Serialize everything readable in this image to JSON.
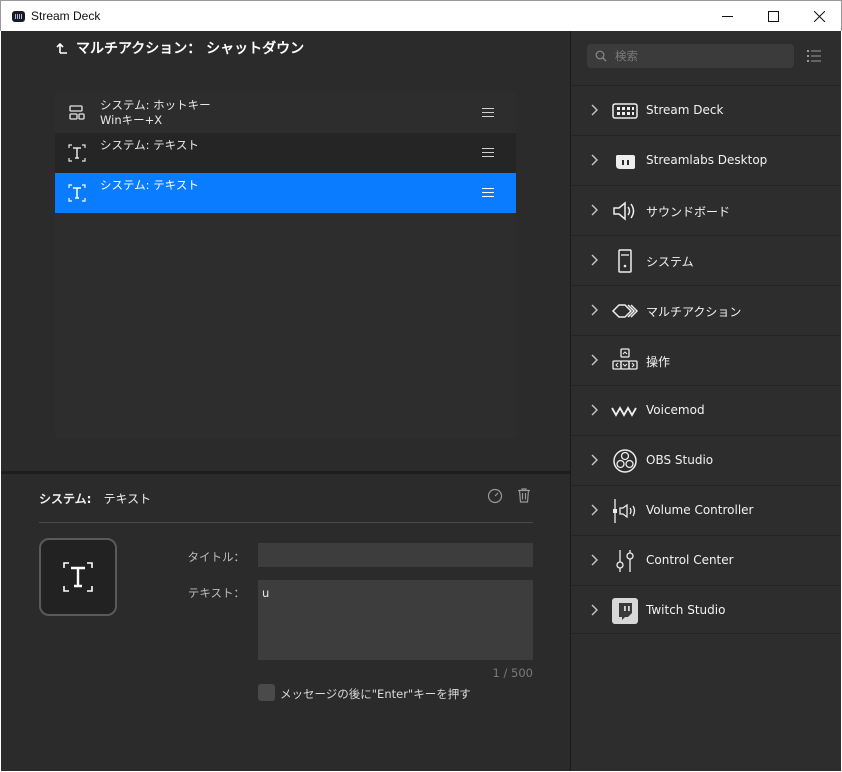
{
  "window": {
    "title": "Stream Deck"
  },
  "editor": {
    "title": "マルチアクション： シャットダウン",
    "actions": [
      {
        "line1": "システム: ホットキー",
        "line2": "Winキー+X",
        "selected": false
      },
      {
        "line1": "システム: テキスト",
        "line2": "",
        "selected": false
      },
      {
        "line1": "システム: テキスト",
        "line2": "",
        "selected": true
      }
    ]
  },
  "properties": {
    "category": "システム:",
    "name": "テキスト",
    "title_label": "タイトル：",
    "title_value": "",
    "text_label": "テキスト：",
    "text_value": "u",
    "counter": "1 / 500",
    "enter_label": "メッセージの後に\"Enter\"キーを押す",
    "enter_checked": false
  },
  "sidebar": {
    "search_placeholder": "検索",
    "categories": [
      {
        "label": "Stream Deck",
        "icon": "stream-deck-icon"
      },
      {
        "label": "Streamlabs Desktop",
        "icon": "streamlabs-icon"
      },
      {
        "label": "サウンドボード",
        "icon": "speaker-icon"
      },
      {
        "label": "システム",
        "icon": "computer-tower-icon"
      },
      {
        "label": "マルチアクション",
        "icon": "multi-action-icon"
      },
      {
        "label": "操作",
        "icon": "arrow-keys-icon"
      },
      {
        "label": "Voicemod",
        "icon": "voicemod-icon"
      },
      {
        "label": "OBS Studio",
        "icon": "obs-icon"
      },
      {
        "label": "Volume Controller",
        "icon": "volume-controller-icon"
      },
      {
        "label": "Control Center",
        "icon": "sliders-icon"
      },
      {
        "label": "Twitch Studio",
        "icon": "twitch-icon"
      }
    ]
  },
  "colors": {
    "accent": "#0a7cff",
    "panel": "#2b2b2b",
    "sidebar": "#2d2d2d"
  }
}
